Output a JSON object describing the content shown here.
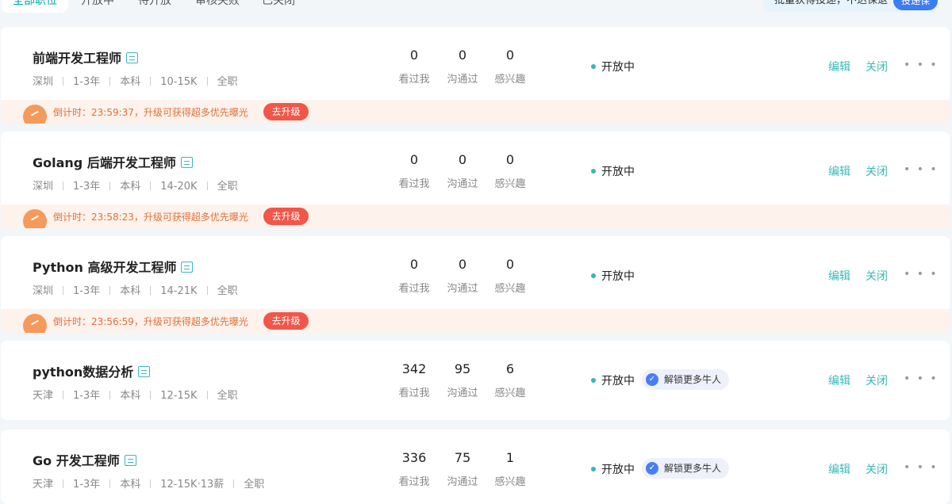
{
  "tabs": [
    "全部职位",
    "开放中",
    "待开放",
    "审核失败",
    "已关闭"
  ],
  "promo": {
    "text": "批量获得投递，不达保退",
    "button": "投递保"
  },
  "countdown_prefix": "倒计时：",
  "countdown_suffix": "，升级可获得超多优先曝光",
  "upgrade_label": "去升级",
  "stat_labels": {
    "viewed": "看过我",
    "talked": "沟通过",
    "interested": "感兴趣"
  },
  "status_label": "开放中",
  "unlock_label": "解锁更多牛人",
  "actions": {
    "edit": "编辑",
    "close": "关闭",
    "more": "• • •"
  },
  "jobs": [
    {
      "title": "前端开发工程师",
      "city": "深圳",
      "experience": "1-3年",
      "degree": "本科",
      "salary": "10-15K",
      "type": "全职",
      "viewed": "0",
      "talked": "0",
      "interested": "0",
      "countdown": "23:59:37"
    },
    {
      "title": "Golang 后端开发工程师",
      "city": "深圳",
      "experience": "1-3年",
      "degree": "本科",
      "salary": "14-20K",
      "type": "全职",
      "viewed": "0",
      "talked": "0",
      "interested": "0",
      "countdown": "23:58:23"
    },
    {
      "title": "Python 高级开发工程师",
      "city": "深圳",
      "experience": "1-3年",
      "degree": "本科",
      "salary": "14-21K",
      "type": "全职",
      "viewed": "0",
      "talked": "0",
      "interested": "0",
      "countdown": "23:56:59"
    },
    {
      "title": "python数据分析",
      "city": "天津",
      "experience": "1-3年",
      "degree": "本科",
      "salary": "12-15K",
      "type": "全职",
      "viewed": "342",
      "talked": "95",
      "interested": "6"
    },
    {
      "title": "Go 开发工程师",
      "city": "天津",
      "experience": "1-3年",
      "degree": "本科",
      "salary": "12-15K·13薪",
      "type": "全职",
      "viewed": "336",
      "talked": "75",
      "interested": "1"
    }
  ]
}
